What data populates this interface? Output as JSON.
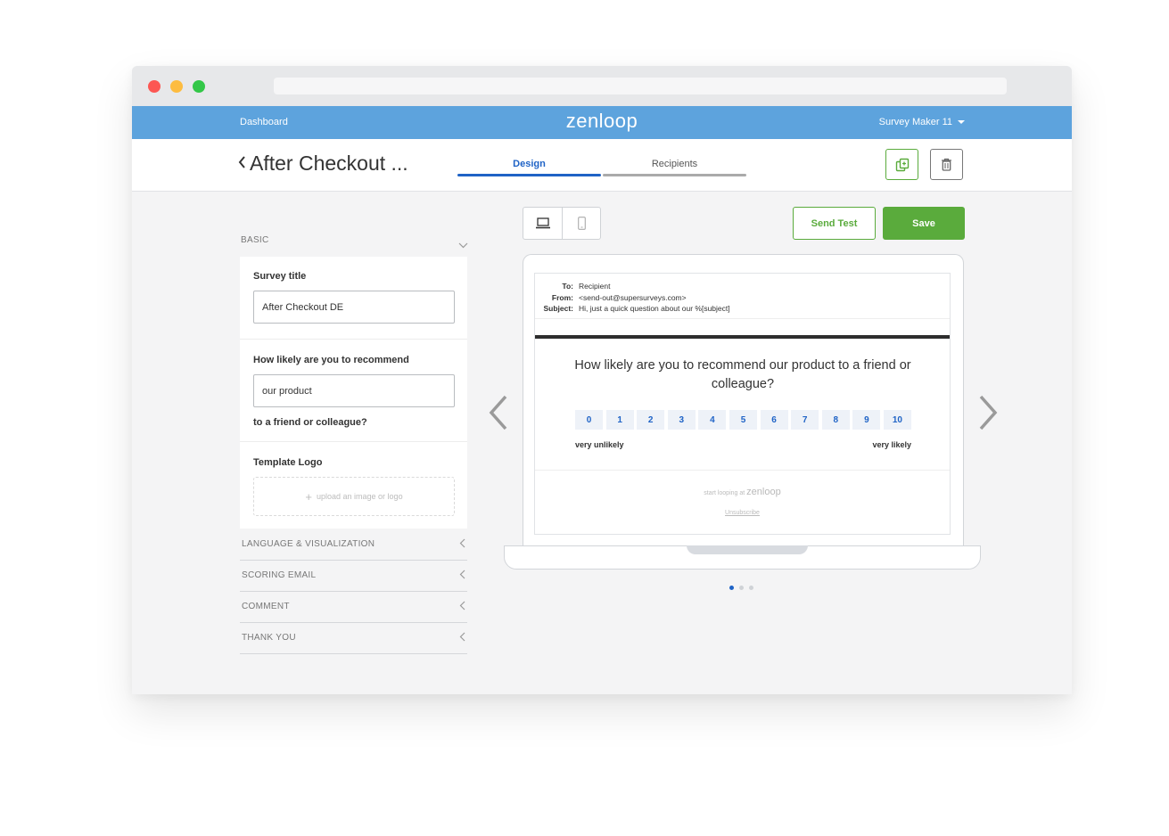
{
  "topnav": {
    "dashboard": "Dashboard",
    "logo": "zenloop",
    "user": "Survey Maker 11"
  },
  "subheader": {
    "survey_name": "After Checkout ...",
    "tabs": [
      {
        "label": "Design",
        "active": true
      },
      {
        "label": "Recipients",
        "active": false
      }
    ],
    "copy_icon": "copy-icon",
    "trash_icon": "trash-icon"
  },
  "sidebar": {
    "basic_title": "BASIC",
    "survey_title_label": "Survey title",
    "survey_title_value": "After Checkout DE",
    "question_label": "How likely are you to recommend",
    "question_value": "our product",
    "question_suffix": "to a friend or colleague?",
    "logo_label": "Template Logo",
    "upload_text": "upload an image or logo",
    "sections": [
      {
        "label": "LANGUAGE & VISUALIZATION"
      },
      {
        "label": "SCORING EMAIL"
      },
      {
        "label": "COMMENT"
      },
      {
        "label": "THANK YOU"
      }
    ]
  },
  "toolbar": {
    "device_desktop_icon": "laptop-icon",
    "device_mobile_icon": "mobile-icon",
    "send_test": "Send Test",
    "save": "Save"
  },
  "preview": {
    "to_label": "To:",
    "to_value": "Recipient",
    "from_label": "From:",
    "from_value": "<send-out@supersurveys.com>",
    "subject_label": "Subject:",
    "subject_value": "Hi, just a quick question about our %[subject]",
    "question": "How likely are you to recommend our product to a friend or colleague?",
    "scale": [
      "0",
      "1",
      "2",
      "3",
      "4",
      "5",
      "6",
      "7",
      "8",
      "9",
      "10"
    ],
    "low_label": "very unlikely",
    "high_label": "very likely",
    "footer_prefix": "start looping at",
    "footer_brand": "zenloop",
    "unsubscribe": "Unsubscribe"
  },
  "pager": {
    "total": 3,
    "active": 0
  },
  "colors": {
    "nav_blue": "#5da3dd",
    "accent_blue": "#1f63c6",
    "green": "#5aab3c",
    "background": "#f4f4f5"
  }
}
